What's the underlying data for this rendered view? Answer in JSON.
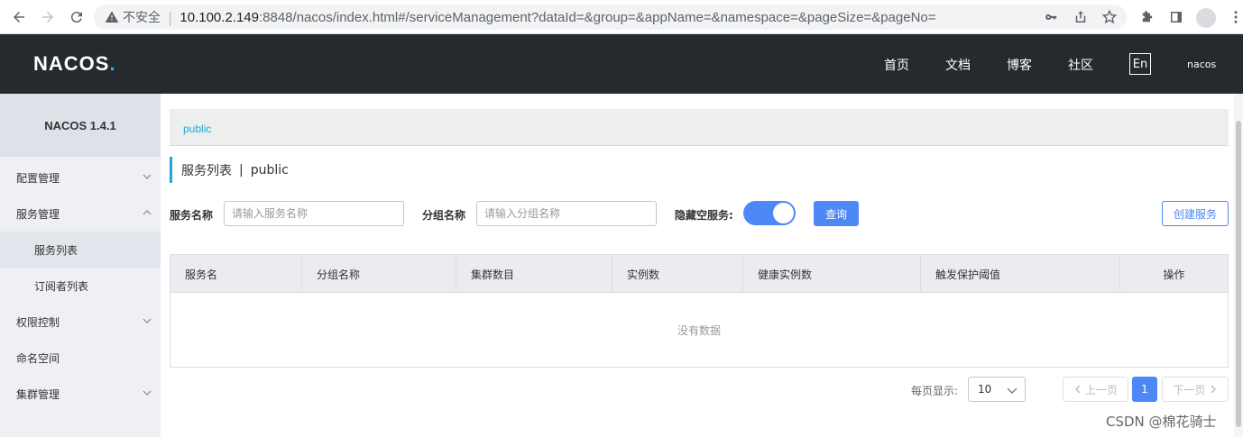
{
  "browser": {
    "insecure_label": "不安全",
    "url_host": "10.100.2.149",
    "url_rest": ":8848/nacos/index.html#/serviceManagement?dataId=&group=&appName=&namespace=&pageSize=&pageNo="
  },
  "header": {
    "logo_main": "NACOS",
    "logo_dot": ".",
    "nav": [
      "首页",
      "文档",
      "博客",
      "社区"
    ],
    "lang": "En",
    "user": "nacos"
  },
  "sidebar": {
    "version": "NACOS 1.4.1",
    "items": [
      {
        "label": "配置管理"
      },
      {
        "label": "服务管理"
      },
      {
        "label": "服务列表"
      },
      {
        "label": "订阅者列表"
      },
      {
        "label": "权限控制"
      },
      {
        "label": "命名空间"
      },
      {
        "label": "集群管理"
      }
    ]
  },
  "main": {
    "breadcrumb": "public",
    "title": "服务列表",
    "title_sep": "|",
    "title_ns": "public",
    "filters": {
      "service_name_label": "服务名称",
      "service_name_placeholder": "请输入服务名称",
      "group_name_label": "分组名称",
      "group_name_placeholder": "请输入分组名称",
      "hide_empty_label": "隐藏空服务:",
      "hide_empty_on": true,
      "query_button": "查询",
      "create_button": "创建服务"
    },
    "table": {
      "columns": [
        "服务名",
        "分组名称",
        "集群数目",
        "实例数",
        "健康实例数",
        "触发保护阈值",
        "操作"
      ],
      "empty_text": "没有数据"
    },
    "pager": {
      "page_size_label": "每页显示:",
      "page_size": "10",
      "prev": "上一页",
      "current_page": "1",
      "next": "下一页"
    }
  },
  "watermark": "CSDN @棉花骑士",
  "colors": {
    "primary": "#4e88f7",
    "header_bg": "#252a2f",
    "accent": "#1aa9dc"
  }
}
